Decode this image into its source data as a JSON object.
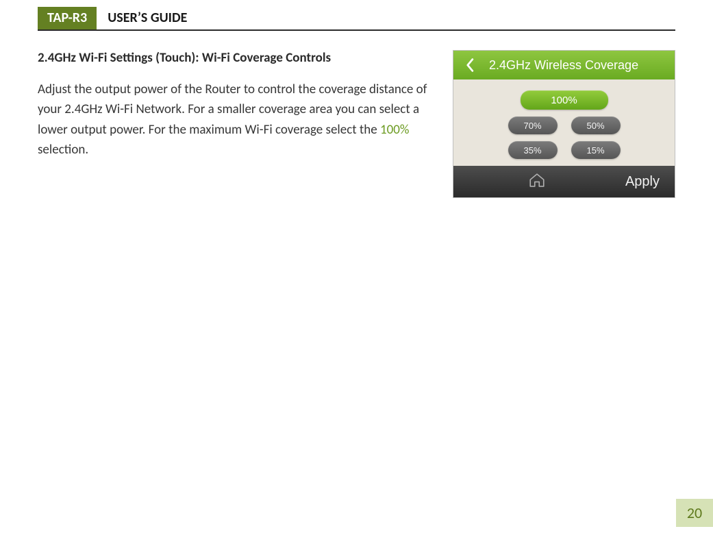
{
  "header": {
    "brand": "TAP-R3",
    "title": "USER’S GUIDE"
  },
  "section": {
    "title": "2.4GHz Wi-Fi Settings (Touch): Wi-Fi Coverage Controls",
    "body_pre": "Adjust the output power of the Router to control the coverage distance of your 2.4GHz Wi-Fi Network. For a smaller coverage area you can select a lower output power. For the maximum Wi-Fi coverage select the ",
    "body_highlight": "100%",
    "body_post": " selection."
  },
  "screenshot": {
    "title": "2.4GHz Wireless Coverage",
    "options": {
      "selected": "100%",
      "row1": [
        "70%",
        "50%"
      ],
      "row2": [
        "35%",
        "15%"
      ]
    },
    "apply": "Apply"
  },
  "page_number": "20"
}
